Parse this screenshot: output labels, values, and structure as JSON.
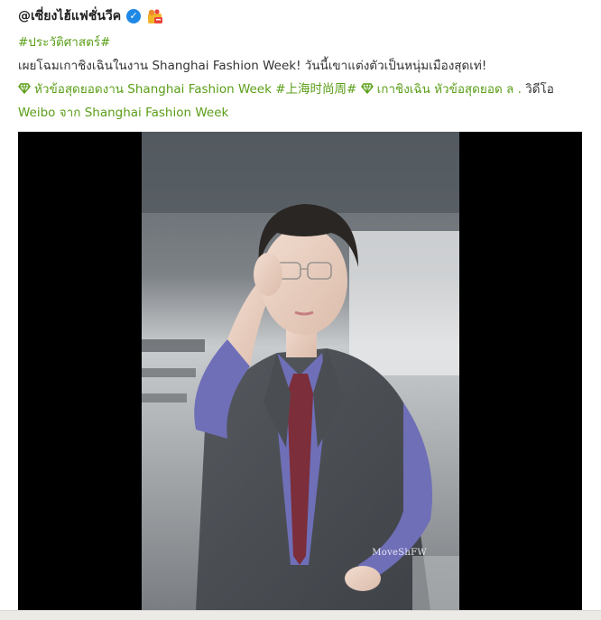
{
  "post": {
    "username": "@เซี่ยงไฮ้แฟชั่นวีค",
    "verified_icon": "verified-check-icon",
    "badge_icon": "vip-badge-icon",
    "hashtag_history": "#ประวัติศาสตร์#",
    "body_text": "เผยโฉมเกาชิงเฉินในงาน Shanghai Fashion Week! วันนี้เขาแต่งตัวเป็นหนุ่มเมืองสุดเท่!",
    "link1": "หัวข้อสุดยอดงาน Shanghai Fashion Week",
    "hashtag_cn": "#上海时尚周#",
    "link2": "เกาชิงเฉิน หัวข้อสุดยอด",
    "video_marker": "ล .",
    "video_text": "วิดีโอ",
    "video_source": "Weibo จาก Shanghai Fashion Week"
  },
  "media": {
    "watermark": "MoveShFW",
    "alt": "video frame"
  },
  "colors": {
    "link_green": "#5a9e17",
    "verified_blue": "#1e88e5"
  }
}
